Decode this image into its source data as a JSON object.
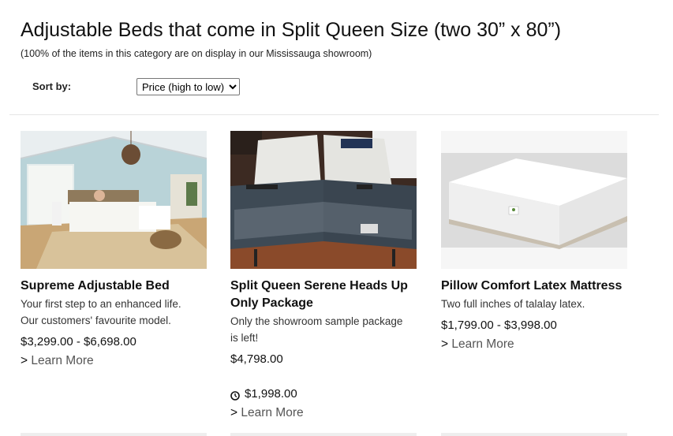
{
  "header": {
    "title": "Adjustable Beds that come in Split Queen Size (two 30” x 80”)",
    "subtitle": "(100% of the items in this category are on display in our Mississauga showroom)"
  },
  "sort": {
    "label": "Sort by:",
    "selected": "Price (high to low)"
  },
  "products": [
    {
      "title": "Supreme Adjustable Bed",
      "description_lines": [
        "Your first step to an enhanced life.",
        "Our customers' favourite model."
      ],
      "price": "$3,299.00 - $6,698.00",
      "learn_more_arrow": ">",
      "learn_more": "Learn More"
    },
    {
      "title_lines": [
        "Split Queen Serene Heads Up",
        "Only Package"
      ],
      "description_lines": [
        "Only the showroom sample package",
        "is left!"
      ],
      "price": "$4,798.00",
      "sale_price": "$1,998.00",
      "sale_icon": "clock-icon",
      "learn_more_arrow": ">",
      "learn_more": "Learn More"
    },
    {
      "title": "Pillow Comfort Latex Mattress",
      "description_lines": [
        "Two full inches of talalay latex."
      ],
      "price": "$1,799.00 - $3,998.00",
      "learn_more_arrow": ">",
      "learn_more": "Learn More"
    }
  ],
  "colors": {
    "text": "#111111",
    "link_gray": "#555555",
    "divider": "#e6e6e6"
  }
}
